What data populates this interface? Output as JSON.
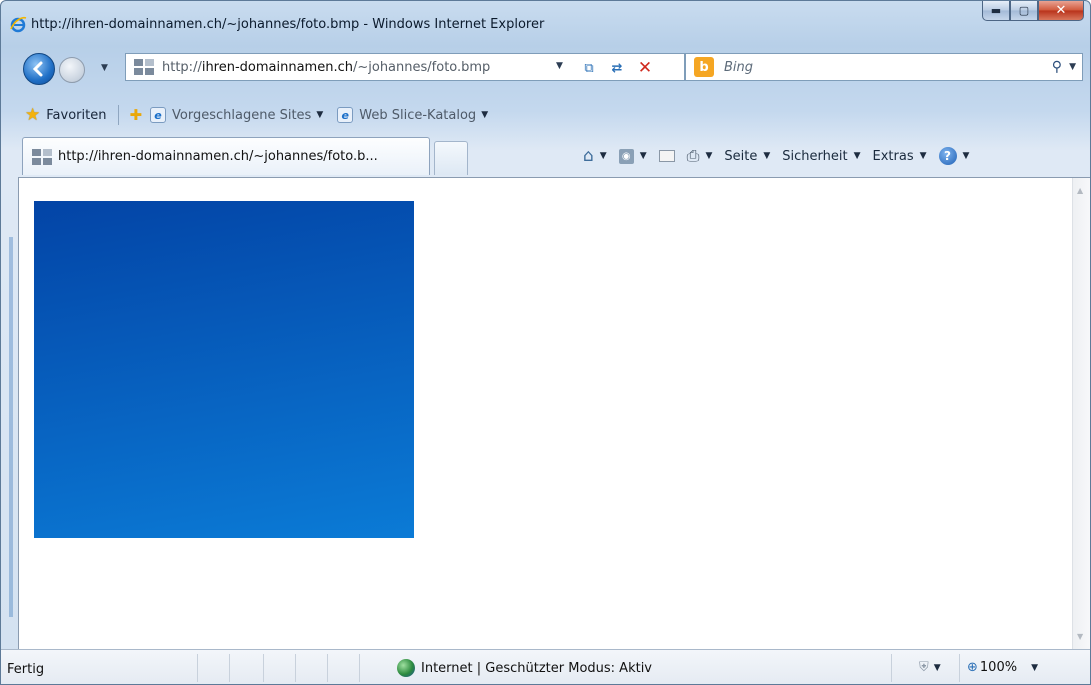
{
  "window": {
    "title": "http://ihren-domainnamen.ch/~johannes/foto.bmp - Windows Internet Explorer",
    "caption_buttons": {
      "minimize": "▬",
      "maximize": "▢",
      "close": "✕"
    }
  },
  "navigation": {
    "back_icon": "back-arrow-icon",
    "forward_icon": "forward-arrow-icon",
    "address": {
      "protocol": "http://",
      "host": "ihren-domainnamen.ch",
      "path": "/~johannes/foto.bmp"
    },
    "search": {
      "placeholder": "Bing",
      "logo": "b"
    }
  },
  "favorites_bar": {
    "favorites_label": "Favoriten",
    "items": [
      {
        "label": "Vorgeschlagene Sites"
      },
      {
        "label": "Web Slice-Katalog"
      }
    ]
  },
  "tab": {
    "label": "http://ihren-domainnamen.ch/~johannes/foto.b..."
  },
  "command_bar": {
    "page_label": "Seite",
    "safety_label": "Sicherheit",
    "tools_label": "Extras",
    "help_glyph": "?"
  },
  "content": {
    "image_colors": {
      "top": "#0344a6",
      "bottom": "#0b7bd6"
    }
  },
  "status_bar": {
    "status_text": "Fertig",
    "zone_text": "Internet | Geschützter Modus: Aktiv",
    "zoom_text": "100%"
  }
}
